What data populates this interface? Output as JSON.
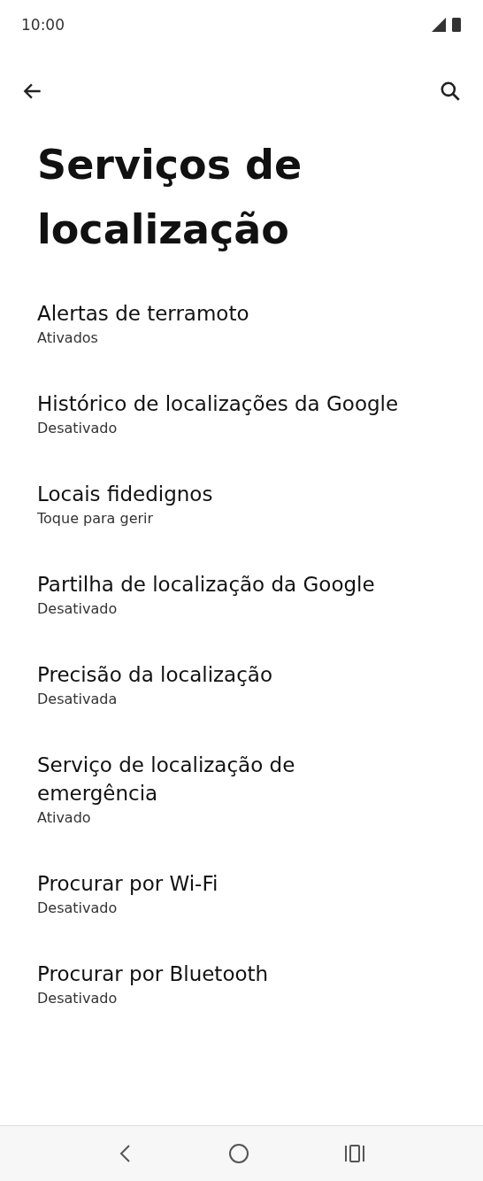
{
  "status_bar": {
    "time": "10:00"
  },
  "title": "Serviços de localização",
  "items": [
    {
      "title": "Alertas de terramoto",
      "subtitle": "Ativados"
    },
    {
      "title": "Histórico de localizações da Google",
      "subtitle": "Desativado"
    },
    {
      "title": "Locais fidedignos",
      "subtitle": "Toque para gerir"
    },
    {
      "title": "Partilha de localização da Google",
      "subtitle": "Desativado"
    },
    {
      "title": "Precisão da localização",
      "subtitle": "Desativada"
    },
    {
      "title": "Serviço de localização de emergência",
      "subtitle": "Ativado"
    },
    {
      "title": "Procurar por Wi-Fi",
      "subtitle": "Desativado"
    },
    {
      "title": "Procurar por Bluetooth",
      "subtitle": "Desativado"
    }
  ]
}
